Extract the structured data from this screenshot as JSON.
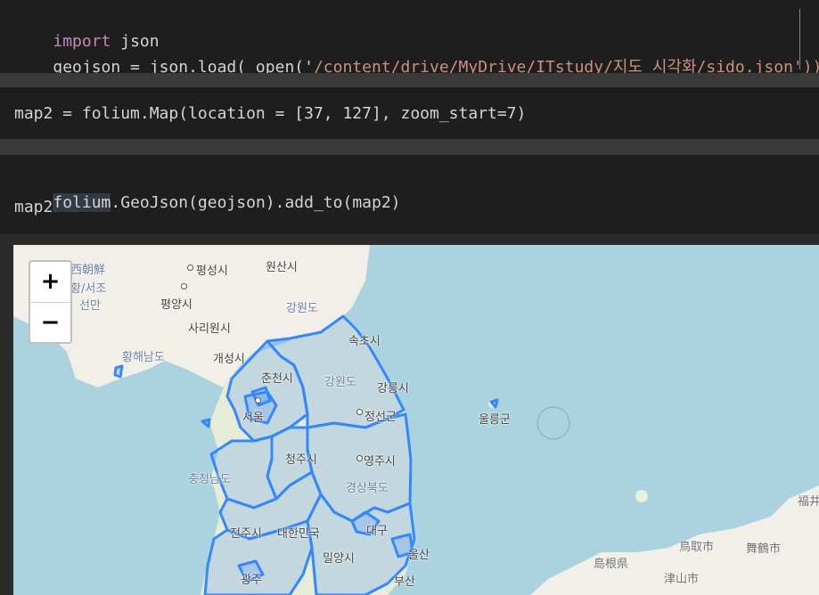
{
  "cells": [
    {
      "line1": {
        "kw": "import",
        "rest": " json"
      },
      "line2": {
        "pre": "geojson = json.load( open('",
        "path": "/content/drive/MyDrive/ITstudy",
        "post": "/지도 시각화/sido.json",
        "end": "'))"
      }
    },
    {
      "line1": "map2 = folium.Map(location = [37, 127], zoom_start=7)"
    },
    {
      "line1_hl": "folium",
      "line1_rest": ".GeoJson(geojson).add_to(map2)",
      "line2": "map2"
    }
  ],
  "map": {
    "zoom_in": "+",
    "zoom_out": "−",
    "places": [
      "평성시",
      "원산시",
      "西朝鮮",
      "황/서조",
      "선만",
      "평양시",
      "강원도",
      "사리원시",
      "속초시",
      "황해남도",
      "개성시",
      "춘천시",
      "강원도",
      "강릉시",
      "울릉군",
      "서울",
      "정선군",
      "청주시",
      "영주시",
      "충청남도",
      "경상북도",
      "대구",
      "전주시",
      "대한민국",
      "울산",
      "밀양시",
      "부산",
      "광주",
      "鳥取市",
      "舞鶴市",
      "島根県",
      "津山市",
      "福井"
    ]
  }
}
